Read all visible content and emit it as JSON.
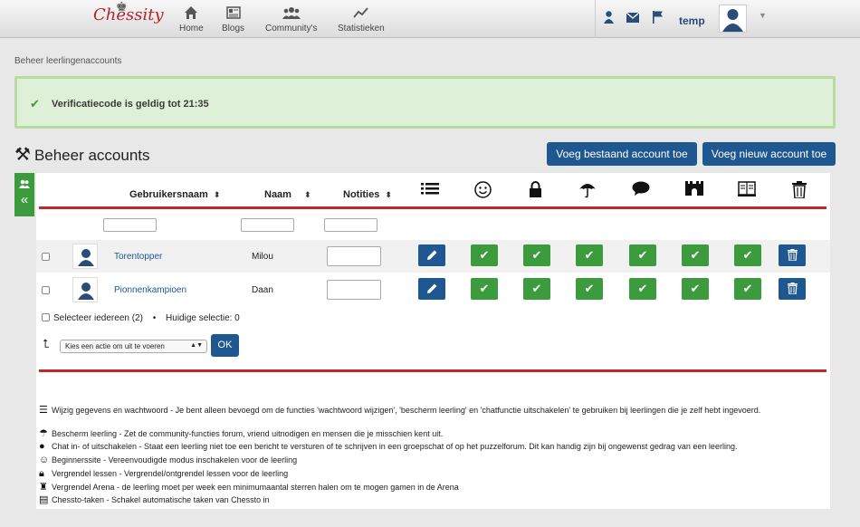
{
  "topbar": {
    "logo": "Chessity",
    "nav": [
      {
        "label": "Home",
        "icon": "home-icon"
      },
      {
        "label": "Blogs",
        "icon": "blog-icon"
      },
      {
        "label": "Community's",
        "icon": "community-icon"
      },
      {
        "label": "Statistieken",
        "icon": "statistics-icon"
      }
    ],
    "username": "temp"
  },
  "breadcrumb": "Beheer leerlingenaccounts",
  "alert": {
    "text": "Verificatiecode is geldig tot 21:35"
  },
  "page_title": "Beheer accounts",
  "buttons": {
    "add_existing": "Voeg bestaand account toe",
    "add_new": "Voeg nieuw account toe",
    "ok": "OK"
  },
  "table": {
    "headers": {
      "username": "Gebruikersnaam",
      "name": "Naam",
      "notes": "Notities"
    },
    "rows": [
      {
        "username": "Torentopper",
        "name": "Milou"
      },
      {
        "username": "Pionnenkampioen",
        "name": "Daan"
      }
    ]
  },
  "selection": {
    "select_all": "Selecteer iedereen (2)",
    "current": "Huidige selectie: 0",
    "action_placeholder": "Kies een actie om uit te voeren"
  },
  "legend": [
    {
      "icon": "list-icon",
      "text": "Wijzig gegevens en wachtwoord - Je bent alleen bevoegd om de functies 'wachtwoord wijzigen', 'bescherm leerling' en 'chatfunctie uitschakelen' te gebruiken bij leerlingen die je zelf hebt ingevoerd."
    },
    {
      "icon": "umbrella-icon",
      "text": "Bescherm leerling - Zet de community-functies forum, vriend uitnodigen en mensen die je misschien kent uit."
    },
    {
      "icon": "chat-icon",
      "text": "Chat in- of uitschakelen - Staat een leerling niet toe een bericht te versturen of te schrijven in een groepschat of op het puzzelforum. Dit kan handig zijn bij ongewenst gedrag van een leerling."
    },
    {
      "icon": "smiley-icon",
      "text": "Beginnerssite - Vereenvoudigde modus inschakelen voor de leerling"
    },
    {
      "icon": "lock-icon",
      "text": "Vergrendel lessen - Vergrendel/ontgrendel lessen voor de leerling"
    },
    {
      "icon": "arena-icon",
      "text": "Vergrendel Arena - de leerling moet per week een minimumaantal sterren halen om te mogen gamen in de Arena"
    },
    {
      "icon": "book-icon",
      "text": "Chessto-taken - Schakel automatische taken van Chessto in"
    }
  ],
  "colors": {
    "primary": "#1f5791",
    "success": "#3c9b3c",
    "danger_line": "#c0282d",
    "alert_bg": "#dff0d8"
  }
}
